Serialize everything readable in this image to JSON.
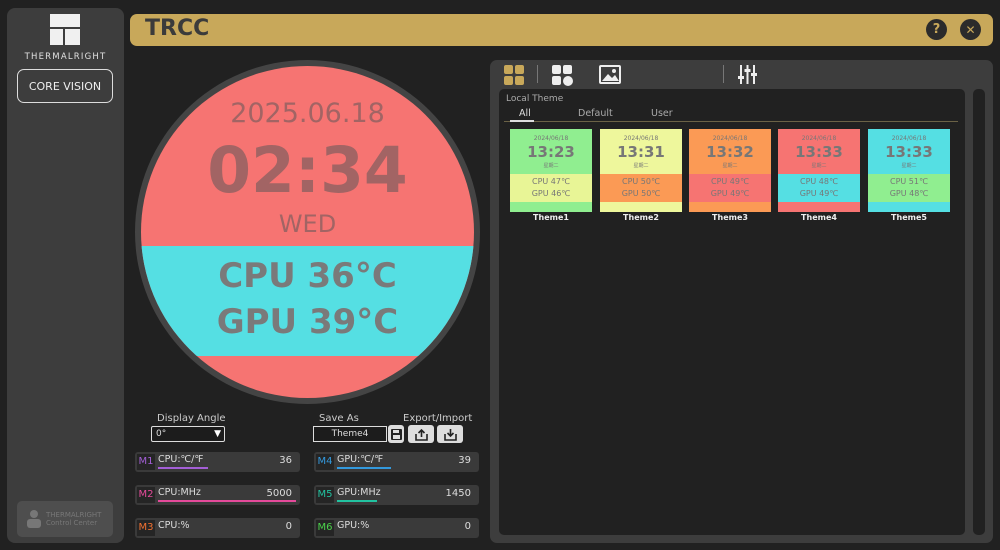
{
  "sidebar": {
    "brand": "THERMALRIGHT",
    "nav_button": "CORE VISION",
    "footer_logo_line1": "THERMALRIGHT",
    "footer_logo_line2": "Control Center"
  },
  "titlebar": {
    "title": "TRCC",
    "help_label": "?",
    "close_label": "✕"
  },
  "preview": {
    "date": "2025.06.18",
    "time": "02:34",
    "day": "WED",
    "cpu": "CPU  36°C",
    "gpu": "GPU  39°C",
    "colors": {
      "background": "#f67472",
      "band": "#55dfe3",
      "text": "#a26464"
    }
  },
  "controls": {
    "display_angle_label": "Display Angle",
    "display_angle_value": "0°",
    "save_as_label": "Save As",
    "save_as_value": "Theme4",
    "export_import_label": "Export/Import"
  },
  "metrics": [
    {
      "tag": "M1",
      "name": "CPU:℃/℉",
      "value": "36",
      "tag_color": "#a35fd6",
      "bar_color": "#a35fd6"
    },
    {
      "tag": "M2",
      "name": "CPU:MHz",
      "value": "5000",
      "tag_color": "#e44a9a",
      "bar_color": "#e44a9a"
    },
    {
      "tag": "M3",
      "name": "CPU:%",
      "value": "0",
      "tag_color": "#f07030",
      "bar_color": ""
    },
    {
      "tag": "M4",
      "name": "GPU:℃/℉",
      "value": "39",
      "tag_color": "#3399dd",
      "bar_color": "#3399dd"
    },
    {
      "tag": "M5",
      "name": "GPU:MHz",
      "value": "1450",
      "tag_color": "#22c2a0",
      "bar_color": "#22c2a0"
    },
    {
      "tag": "M6",
      "name": "GPU:%",
      "value": "0",
      "tag_color": "#4bd14b",
      "bar_color": ""
    }
  ],
  "themes_panel": {
    "section_label": "Local Theme",
    "tabs": [
      "All",
      "Default",
      "User"
    ],
    "themes": [
      {
        "name": "Theme1",
        "date": "2024/06/18",
        "time": "13:23",
        "day": "星期二",
        "cpu": "CPU  47℃",
        "gpu": "GPU  46℃",
        "top": "#90ee90",
        "mid": "#e8f596",
        "bot": "#90ee90"
      },
      {
        "name": "Theme2",
        "date": "2024/06/18",
        "time": "13:31",
        "day": "星期二",
        "cpu": "CPU  50℃",
        "gpu": "GPU  50℃",
        "top": "#eef79c",
        "mid": "#fb9a55",
        "bot": "#eef79c"
      },
      {
        "name": "Theme3",
        "date": "2024/06/18",
        "time": "13:32",
        "day": "星期二",
        "cpu": "CPU  49℃",
        "gpu": "GPU  49℃",
        "top": "#fb9a55",
        "mid": "#f67472",
        "bot": "#fb9a55"
      },
      {
        "name": "Theme4",
        "date": "2024/06/18",
        "time": "13:33",
        "day": "星期二",
        "cpu": "CPU  48℃",
        "gpu": "GPU  49℃",
        "top": "#f67472",
        "mid": "#55dfe3",
        "bot": "#f67472"
      },
      {
        "name": "Theme5",
        "date": "2024/06/18",
        "time": "13:33",
        "day": "星期二",
        "cpu": "CPU  51℃",
        "gpu": "GPU  48℃",
        "top": "#55dfe3",
        "mid": "#90ee90",
        "bot": "#55dfe3"
      }
    ]
  },
  "colors": {
    "accent": "#c8a85a",
    "panel": "#3d3d3d",
    "background": "#212121"
  }
}
